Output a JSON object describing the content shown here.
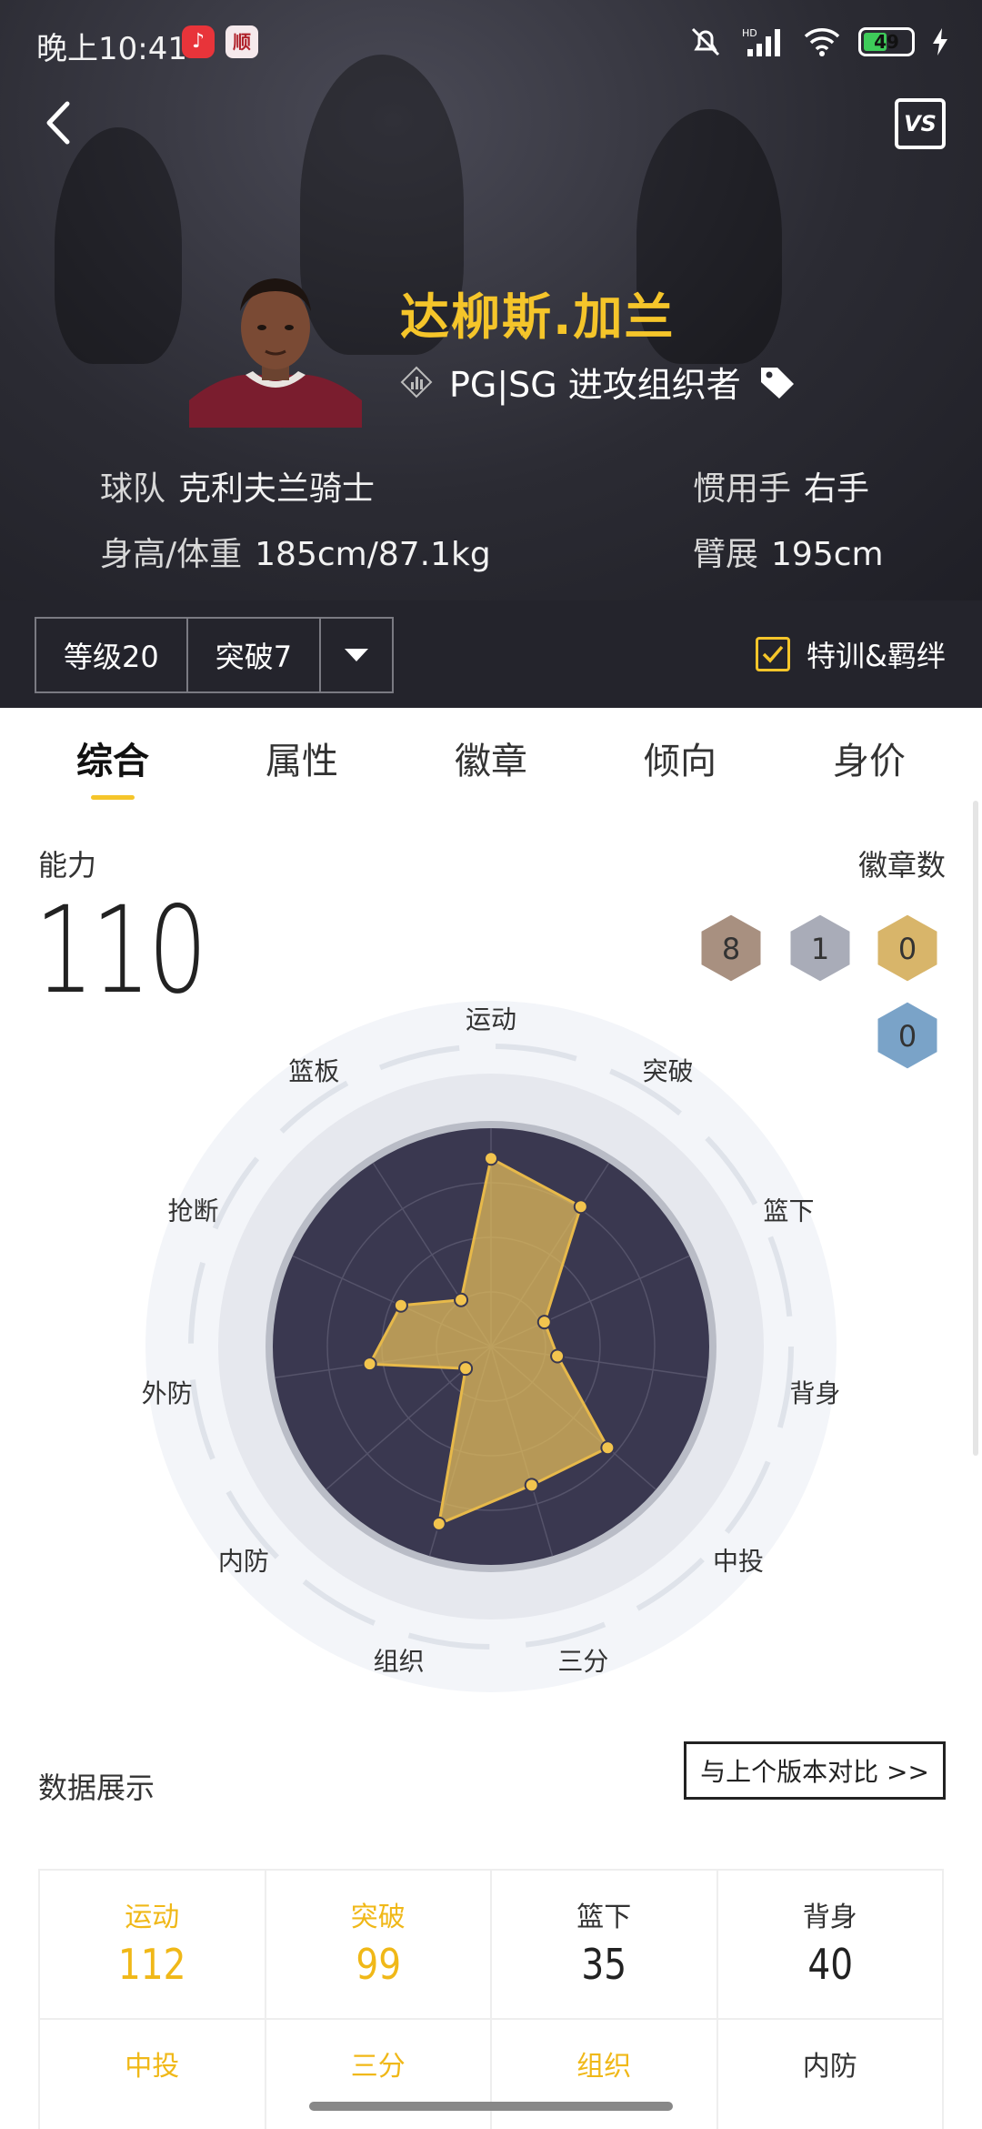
{
  "status": {
    "time": "晚上10:41",
    "battery": "49",
    "hd": "HD"
  },
  "header": {
    "vs_label": "VS"
  },
  "player": {
    "name": "达柳斯.加兰",
    "position": "PG|SG 进攻组织者",
    "team_label": "球队",
    "team": "克利夫兰骑士",
    "hand_label": "惯用手",
    "hand": "右手",
    "body_label": "身高/体重",
    "body": "185cm/87.1kg",
    "wingspan_label": "臂展",
    "wingspan": "195cm"
  },
  "levelbar": {
    "level": "等级20",
    "breakthrough": "突破7",
    "special": "特训&羁绊"
  },
  "tabs": [
    "综合",
    "属性",
    "徽章",
    "倾向",
    "身价"
  ],
  "ability": {
    "label": "能力",
    "value": "110",
    "badge_label": "徽章数",
    "badges": [
      {
        "count": "8",
        "color": "#a89080"
      },
      {
        "count": "1",
        "color": "#a9acb8"
      },
      {
        "count": "0",
        "color": "#d8b56a"
      },
      {
        "count": "0",
        "color": "#7aa3c8"
      }
    ]
  },
  "chart_data": {
    "type": "radar",
    "axes": [
      "运动",
      "突破",
      "篮下",
      "背身",
      "中投",
      "三分",
      "组织",
      "内防",
      "外防",
      "抢断",
      "篮板"
    ],
    "values": [
      112,
      99,
      35,
      40,
      92,
      86,
      110,
      20,
      73,
      59,
      33
    ],
    "max": 130
  },
  "data_section": {
    "title": "数据展示",
    "compare": "与上个版本对比 >>",
    "stats": [
      {
        "k": "运动",
        "v": "112",
        "hl": true
      },
      {
        "k": "突破",
        "v": "99",
        "hl": true
      },
      {
        "k": "篮下",
        "v": "35",
        "hl": false
      },
      {
        "k": "背身",
        "v": "40",
        "hl": false
      },
      {
        "k": "中投",
        "v": "",
        "hl": true
      },
      {
        "k": "三分",
        "v": "",
        "hl": true
      },
      {
        "k": "组织",
        "v": "",
        "hl": true
      },
      {
        "k": "内防",
        "v": "",
        "hl": false
      }
    ]
  }
}
